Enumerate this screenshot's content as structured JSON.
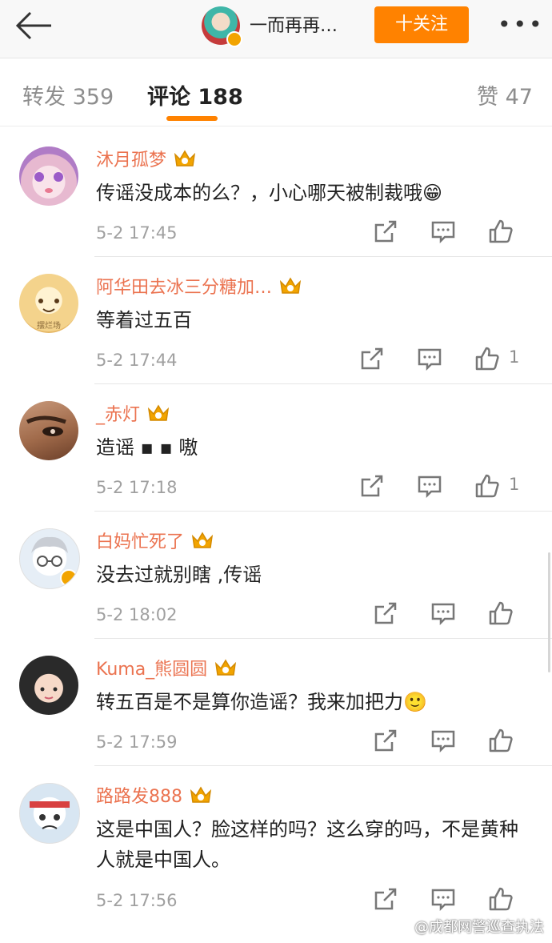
{
  "header": {
    "title": "一而再再…",
    "follow_label": "十关注",
    "more_label": "•••"
  },
  "tabs": [
    {
      "label": "转发 359"
    },
    {
      "label": "评论 188"
    },
    {
      "label": "赞 47"
    }
  ],
  "comments": [
    {
      "user": "沐月孤梦",
      "text": "传谣没成本的么？，小心哪天被制裁哦😁",
      "time": "5-2 17:45",
      "likes": ""
    },
    {
      "user": "阿华田去冰三分糖加…",
      "text": "等着过五百",
      "time": "5-2 17:44",
      "likes": "1"
    },
    {
      "user": "_赤灯",
      "text": "造谣 ▪ ▪ 嗷",
      "time": "5-2 17:18",
      "likes": "1"
    },
    {
      "user": "白妈忙死了",
      "text": "没去过就别瞎  ,传谣",
      "time": "5-2 18:02",
      "likes": ""
    },
    {
      "user": "Kuma_熊圆圆",
      "text": "转五百是不是算你造谣？我来加把力🙂",
      "time": "5-2 17:59",
      "likes": ""
    },
    {
      "user": "路路发888",
      "text": "这是中国人？脸这样的吗？这么穿的吗，不是黄种人就是中国人。",
      "time": "5-2 17:56",
      "likes": ""
    }
  ],
  "watermark": "@成都网警巡查执法",
  "colors": {
    "accent": "#ff8200",
    "username": "#eb7350",
    "crown": "#f2a400"
  }
}
